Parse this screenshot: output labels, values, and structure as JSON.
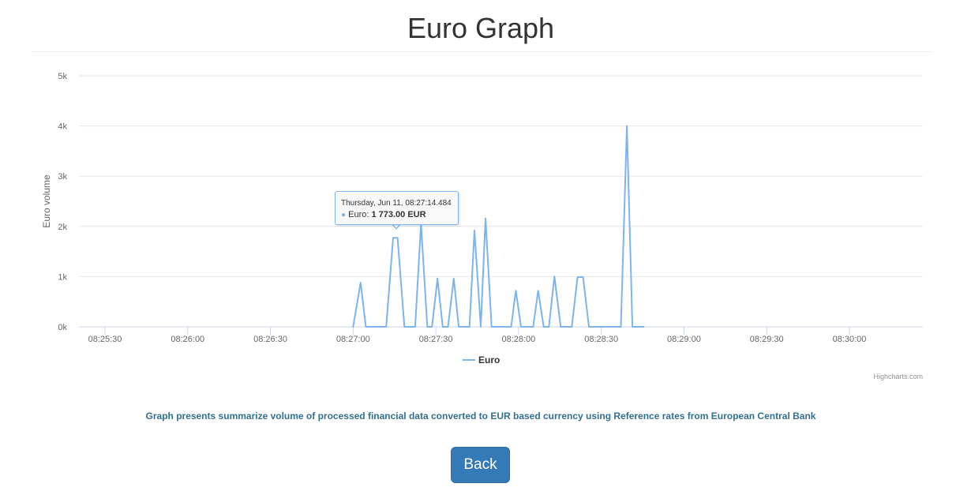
{
  "page": {
    "title": "Euro Graph",
    "caption": "Graph presents summarize volume of processed financial data converted to EUR based currency using Reference rates from European Central Bank",
    "back_label": "Back"
  },
  "chart_data": {
    "type": "line",
    "title": "",
    "ylabel": "Euro volume",
    "xlabel": "",
    "ylim": [
      0,
      5000
    ],
    "y_ticks": [
      0,
      1000,
      2000,
      3000,
      4000,
      5000
    ],
    "y_tick_labels": [
      "0k",
      "1k",
      "2k",
      "3k",
      "4k",
      "5k"
    ],
    "x_range": [
      "08:25:30",
      "08:30:00"
    ],
    "x_ticks": [
      "08:25:30",
      "08:26:00",
      "08:26:30",
      "08:27:00",
      "08:27:30",
      "08:28:00",
      "08:28:30",
      "08:29:00",
      "08:29:30",
      "08:30:00"
    ],
    "grid": true,
    "legend_position": "bottom-center",
    "credit": "Highcharts.com",
    "color": "#7cb5ec",
    "series": [
      {
        "name": "Euro",
        "points": [
          [
            "08:27:00.0",
            0
          ],
          [
            "08:27:02.7",
            880
          ],
          [
            "08:27:04.6",
            0
          ],
          [
            "08:27:12.0",
            0
          ],
          [
            "08:27:14.5",
            1773
          ],
          [
            "08:27:16.1",
            1773
          ],
          [
            "08:27:18.6",
            0
          ],
          [
            "08:27:22.5",
            0
          ],
          [
            "08:27:24.6",
            2050
          ],
          [
            "08:27:26.9",
            0
          ],
          [
            "08:27:28.6",
            0
          ],
          [
            "08:27:30.6",
            960
          ],
          [
            "08:27:32.5",
            0
          ],
          [
            "08:27:34.4",
            0
          ],
          [
            "08:27:36.5",
            960
          ],
          [
            "08:27:38.3",
            0
          ],
          [
            "08:27:42.2",
            0
          ],
          [
            "08:27:44.0",
            1920
          ],
          [
            "08:27:46.3",
            0
          ],
          [
            "08:27:48.0",
            2160
          ],
          [
            "08:27:50.2",
            0
          ],
          [
            "08:27:57.3",
            0
          ],
          [
            "08:27:59.0",
            720
          ],
          [
            "08:28:00.9",
            0
          ],
          [
            "08:28:05.3",
            0
          ],
          [
            "08:28:07.1",
            720
          ],
          [
            "08:28:09.1",
            0
          ],
          [
            "08:28:11.0",
            0
          ],
          [
            "08:28:13.0",
            1000
          ],
          [
            "08:28:15.3",
            0
          ],
          [
            "08:28:19.3",
            0
          ],
          [
            "08:28:21.4",
            990
          ],
          [
            "08:28:23.4",
            990
          ],
          [
            "08:28:25.5",
            0
          ],
          [
            "08:28:37.1",
            0
          ],
          [
            "08:28:39.3",
            4000
          ],
          [
            "08:28:41.3",
            0
          ],
          [
            "08:28:45.4",
            0
          ]
        ]
      }
    ],
    "tooltip": {
      "header": "Thursday, Jun 11, 08:27:14.484",
      "series_label": "Euro: ",
      "value": "1 773.00 EUR"
    }
  }
}
